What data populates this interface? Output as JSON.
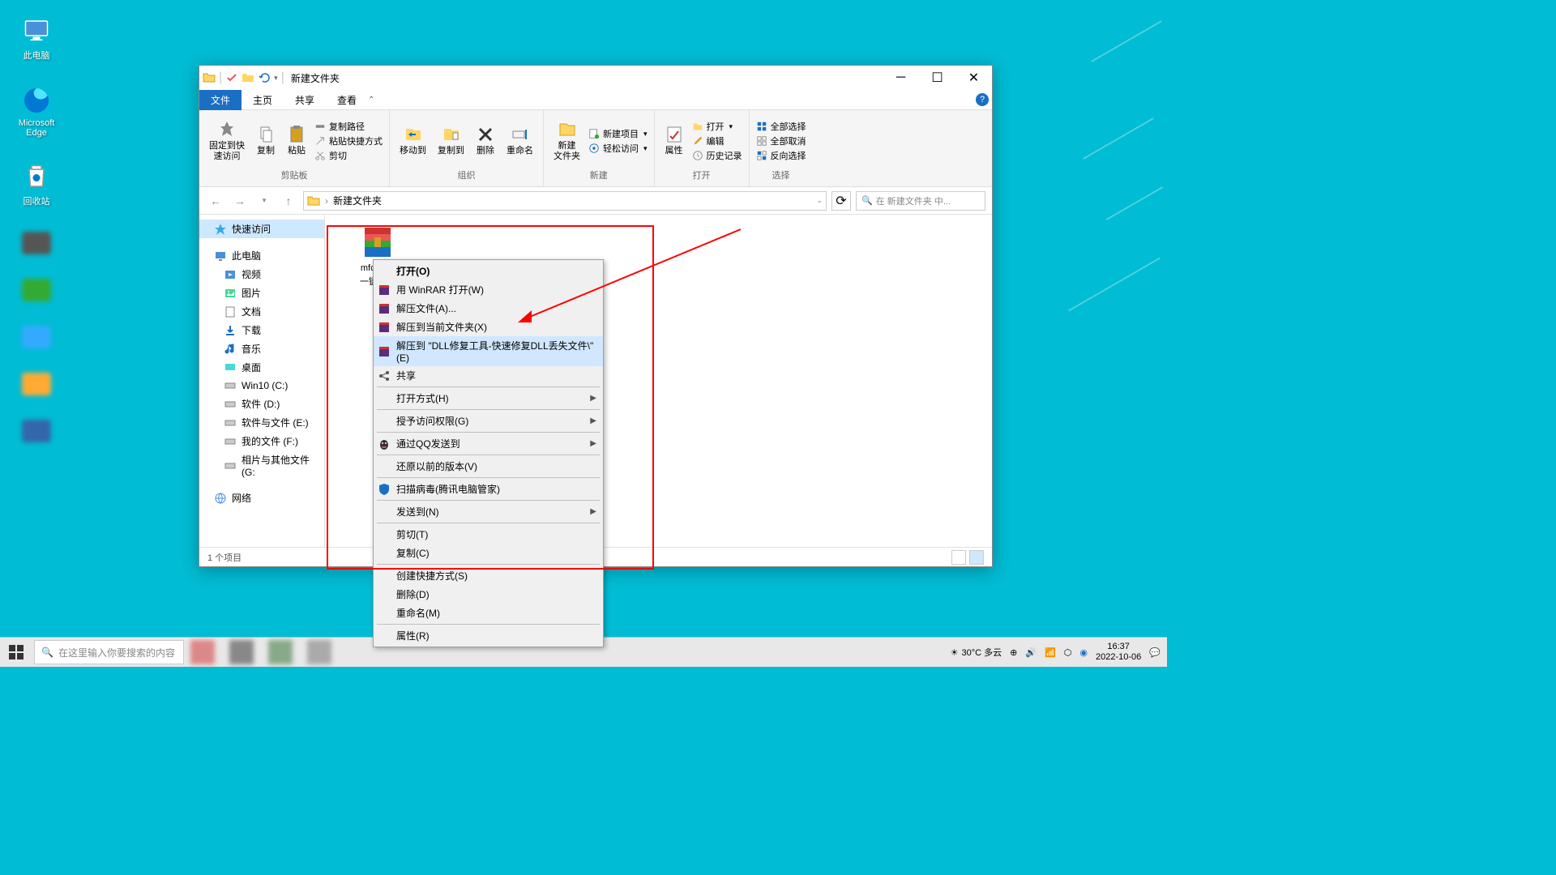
{
  "desktop": {
    "icons": [
      {
        "name": "此电脑",
        "type": "pc"
      },
      {
        "name": "Microsoft Edge",
        "type": "edge"
      },
      {
        "name": "回收站",
        "type": "recycle"
      }
    ]
  },
  "explorer": {
    "title": "新建文件夹",
    "tabs": {
      "file": "文件",
      "home": "主页",
      "share": "共享",
      "view": "查看"
    },
    "ribbon": {
      "clipboard": {
        "label": "剪贴板",
        "pin": "固定到快\n速访问",
        "copy": "复制",
        "paste": "粘贴",
        "copy_path": "复制路径",
        "paste_shortcut": "粘贴快捷方式",
        "cut": "剪切"
      },
      "organize": {
        "label": "组织",
        "move": "移动到",
        "copy_to": "复制到",
        "delete": "删除",
        "rename": "重命名"
      },
      "new": {
        "label": "新建",
        "folder": "新建\n文件夹",
        "new_item": "新建项目",
        "easy_access": "轻松访问"
      },
      "open": {
        "label": "打开",
        "props": "属性",
        "open": "打开",
        "edit": "编辑",
        "history": "历史记录"
      },
      "select": {
        "label": "选择",
        "all": "全部选择",
        "none": "全部取消",
        "invert": "反向选择"
      }
    },
    "breadcrumb": "新建文件夹",
    "search_placeholder": "在 新建文件夹 中...",
    "sidebar": {
      "quick": "快速访问",
      "this_pc": "此电脑",
      "items": [
        "视频",
        "图片",
        "文档",
        "下载",
        "音乐",
        "桌面"
      ],
      "drives": [
        "Win10 (C:)",
        "软件 (D:)",
        "软件与文件 (E:)",
        "我的文件 (F:)",
        "相片与其他文件 (G:"
      ],
      "network": "网络"
    },
    "file": {
      "name": "mfc140u",
      "sub": "一键修复"
    },
    "status": "1 个项目"
  },
  "context_menu": {
    "open": "打开(O)",
    "winrar_open": "用 WinRAR 打开(W)",
    "extract": "解压文件(A)...",
    "extract_here": "解压到当前文件夹(X)",
    "extract_to": "解压到 \"DLL修复工具-快速修复DLL丢失文件\\\"(E)",
    "share": "共享",
    "open_with": "打开方式(H)",
    "grant_access": "授予访问权限(G)",
    "qq_send": "通过QQ发送到",
    "restore": "还原以前的版本(V)",
    "scan": "扫描病毒(腾讯电脑管家)",
    "send_to": "发送到(N)",
    "cut": "剪切(T)",
    "copy": "复制(C)",
    "shortcut": "创建快捷方式(S)",
    "delete": "删除(D)",
    "rename": "重命名(M)",
    "properties": "属性(R)"
  },
  "taskbar": {
    "search": "在这里输入你要搜索的内容",
    "weather": "30°C 多云",
    "time": "16:37",
    "date": "2022-10-06"
  }
}
